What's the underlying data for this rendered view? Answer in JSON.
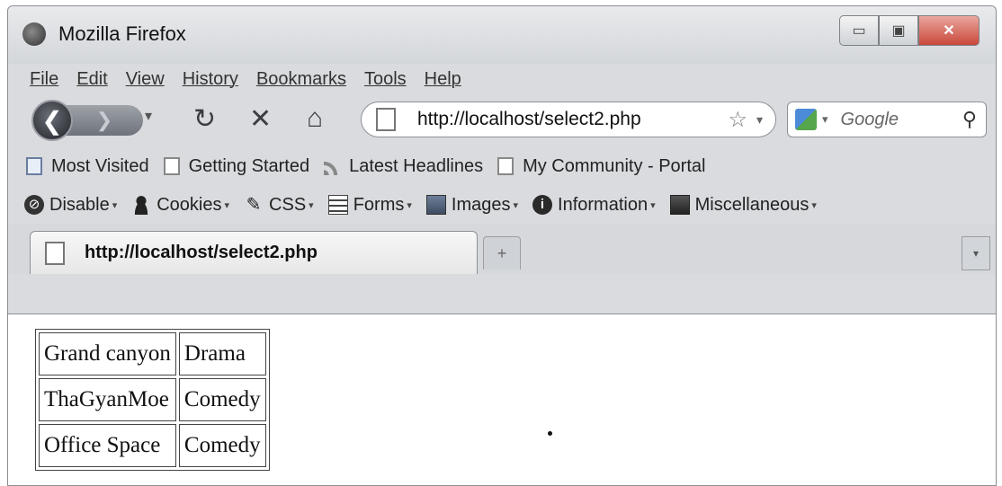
{
  "window": {
    "title": "Mozilla Firefox"
  },
  "menubar": {
    "items": [
      "File",
      "Edit",
      "View",
      "History",
      "Bookmarks",
      "Tools",
      "Help"
    ]
  },
  "navbar": {
    "url": "http://localhost/select2.php",
    "search_placeholder": "Google"
  },
  "bookmarks": {
    "items": [
      "Most Visited",
      "Getting Started",
      "Latest Headlines",
      "My Community - Portal"
    ]
  },
  "devbar": {
    "items": [
      "Disable",
      "Cookies",
      "CSS",
      "Forms",
      "Images",
      "Information",
      "Miscellaneous"
    ]
  },
  "tab": {
    "title": "http://localhost/select2.php"
  },
  "table": {
    "rows": [
      [
        "Grand canyon",
        "Drama"
      ],
      [
        "ThaGyanMoe",
        "Comedy"
      ],
      [
        "Office Space",
        "Comedy"
      ]
    ]
  }
}
